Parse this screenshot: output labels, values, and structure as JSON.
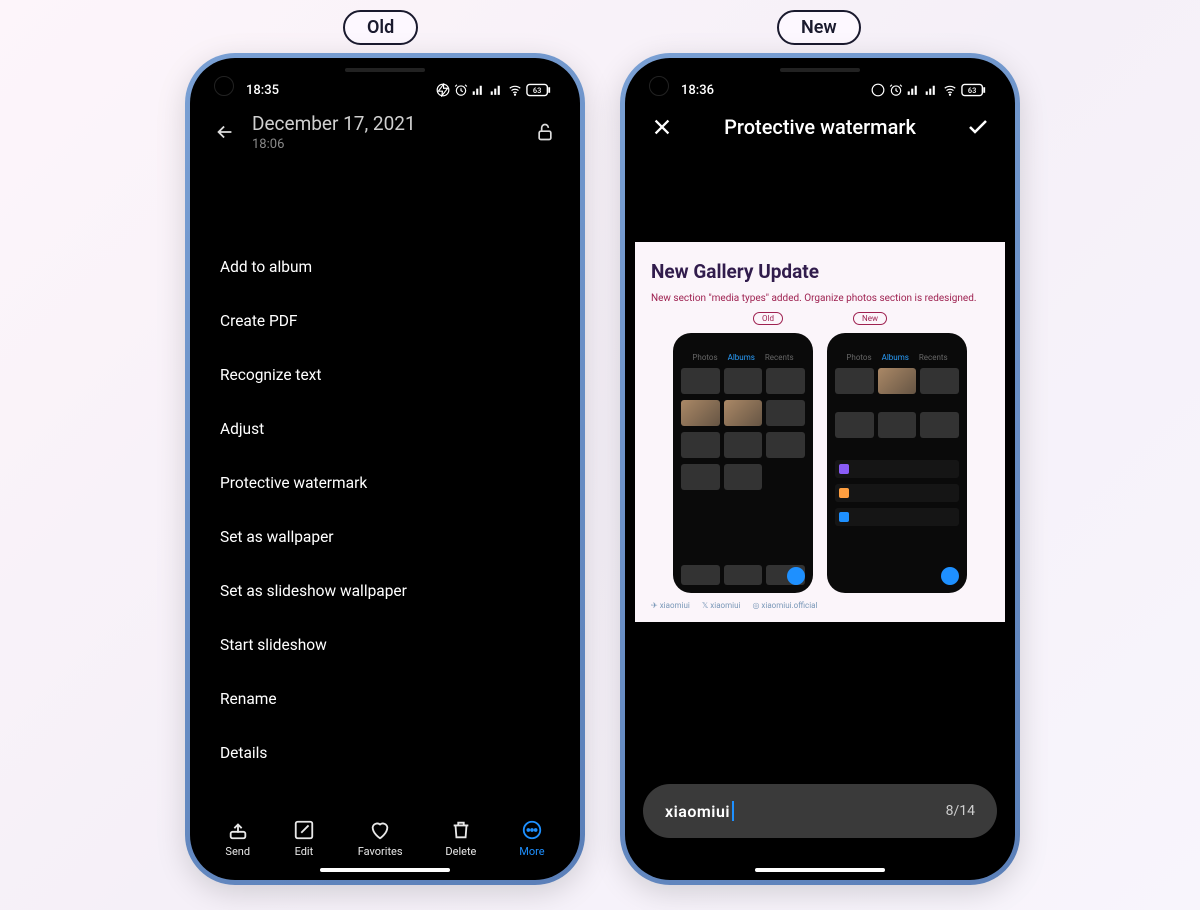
{
  "labels": {
    "old": "Old",
    "new": "New"
  },
  "left": {
    "status_time": "18:35",
    "title_date": "December 17, 2021",
    "title_time": "18:06",
    "menu": [
      "Add to album",
      "Create PDF",
      "Recognize text",
      "Adjust",
      "Protective watermark",
      "Set as wallpaper",
      "Set as slideshow wallpaper",
      "Start slideshow",
      "Rename",
      "Details"
    ],
    "bottom": {
      "send": "Send",
      "edit": "Edit",
      "favorites": "Favorites",
      "delete": "Delete",
      "more": "More"
    }
  },
  "right": {
    "status_time": "18:36",
    "header": "Protective watermark",
    "preview": {
      "title": "New Gallery Update",
      "subtitle": "New section \"media types\" added. Organize photos section is redesigned.",
      "old": "Old",
      "new": "New",
      "tabs": {
        "photos": "Photos",
        "albums": "Albums",
        "recents": "Recents"
      },
      "socials": {
        "tg": "xiaomiui",
        "tw": "xiaomiui",
        "ig": "xiaomiui.official"
      }
    },
    "watermark": {
      "text": "xiaomiui",
      "count": "8/14"
    }
  }
}
